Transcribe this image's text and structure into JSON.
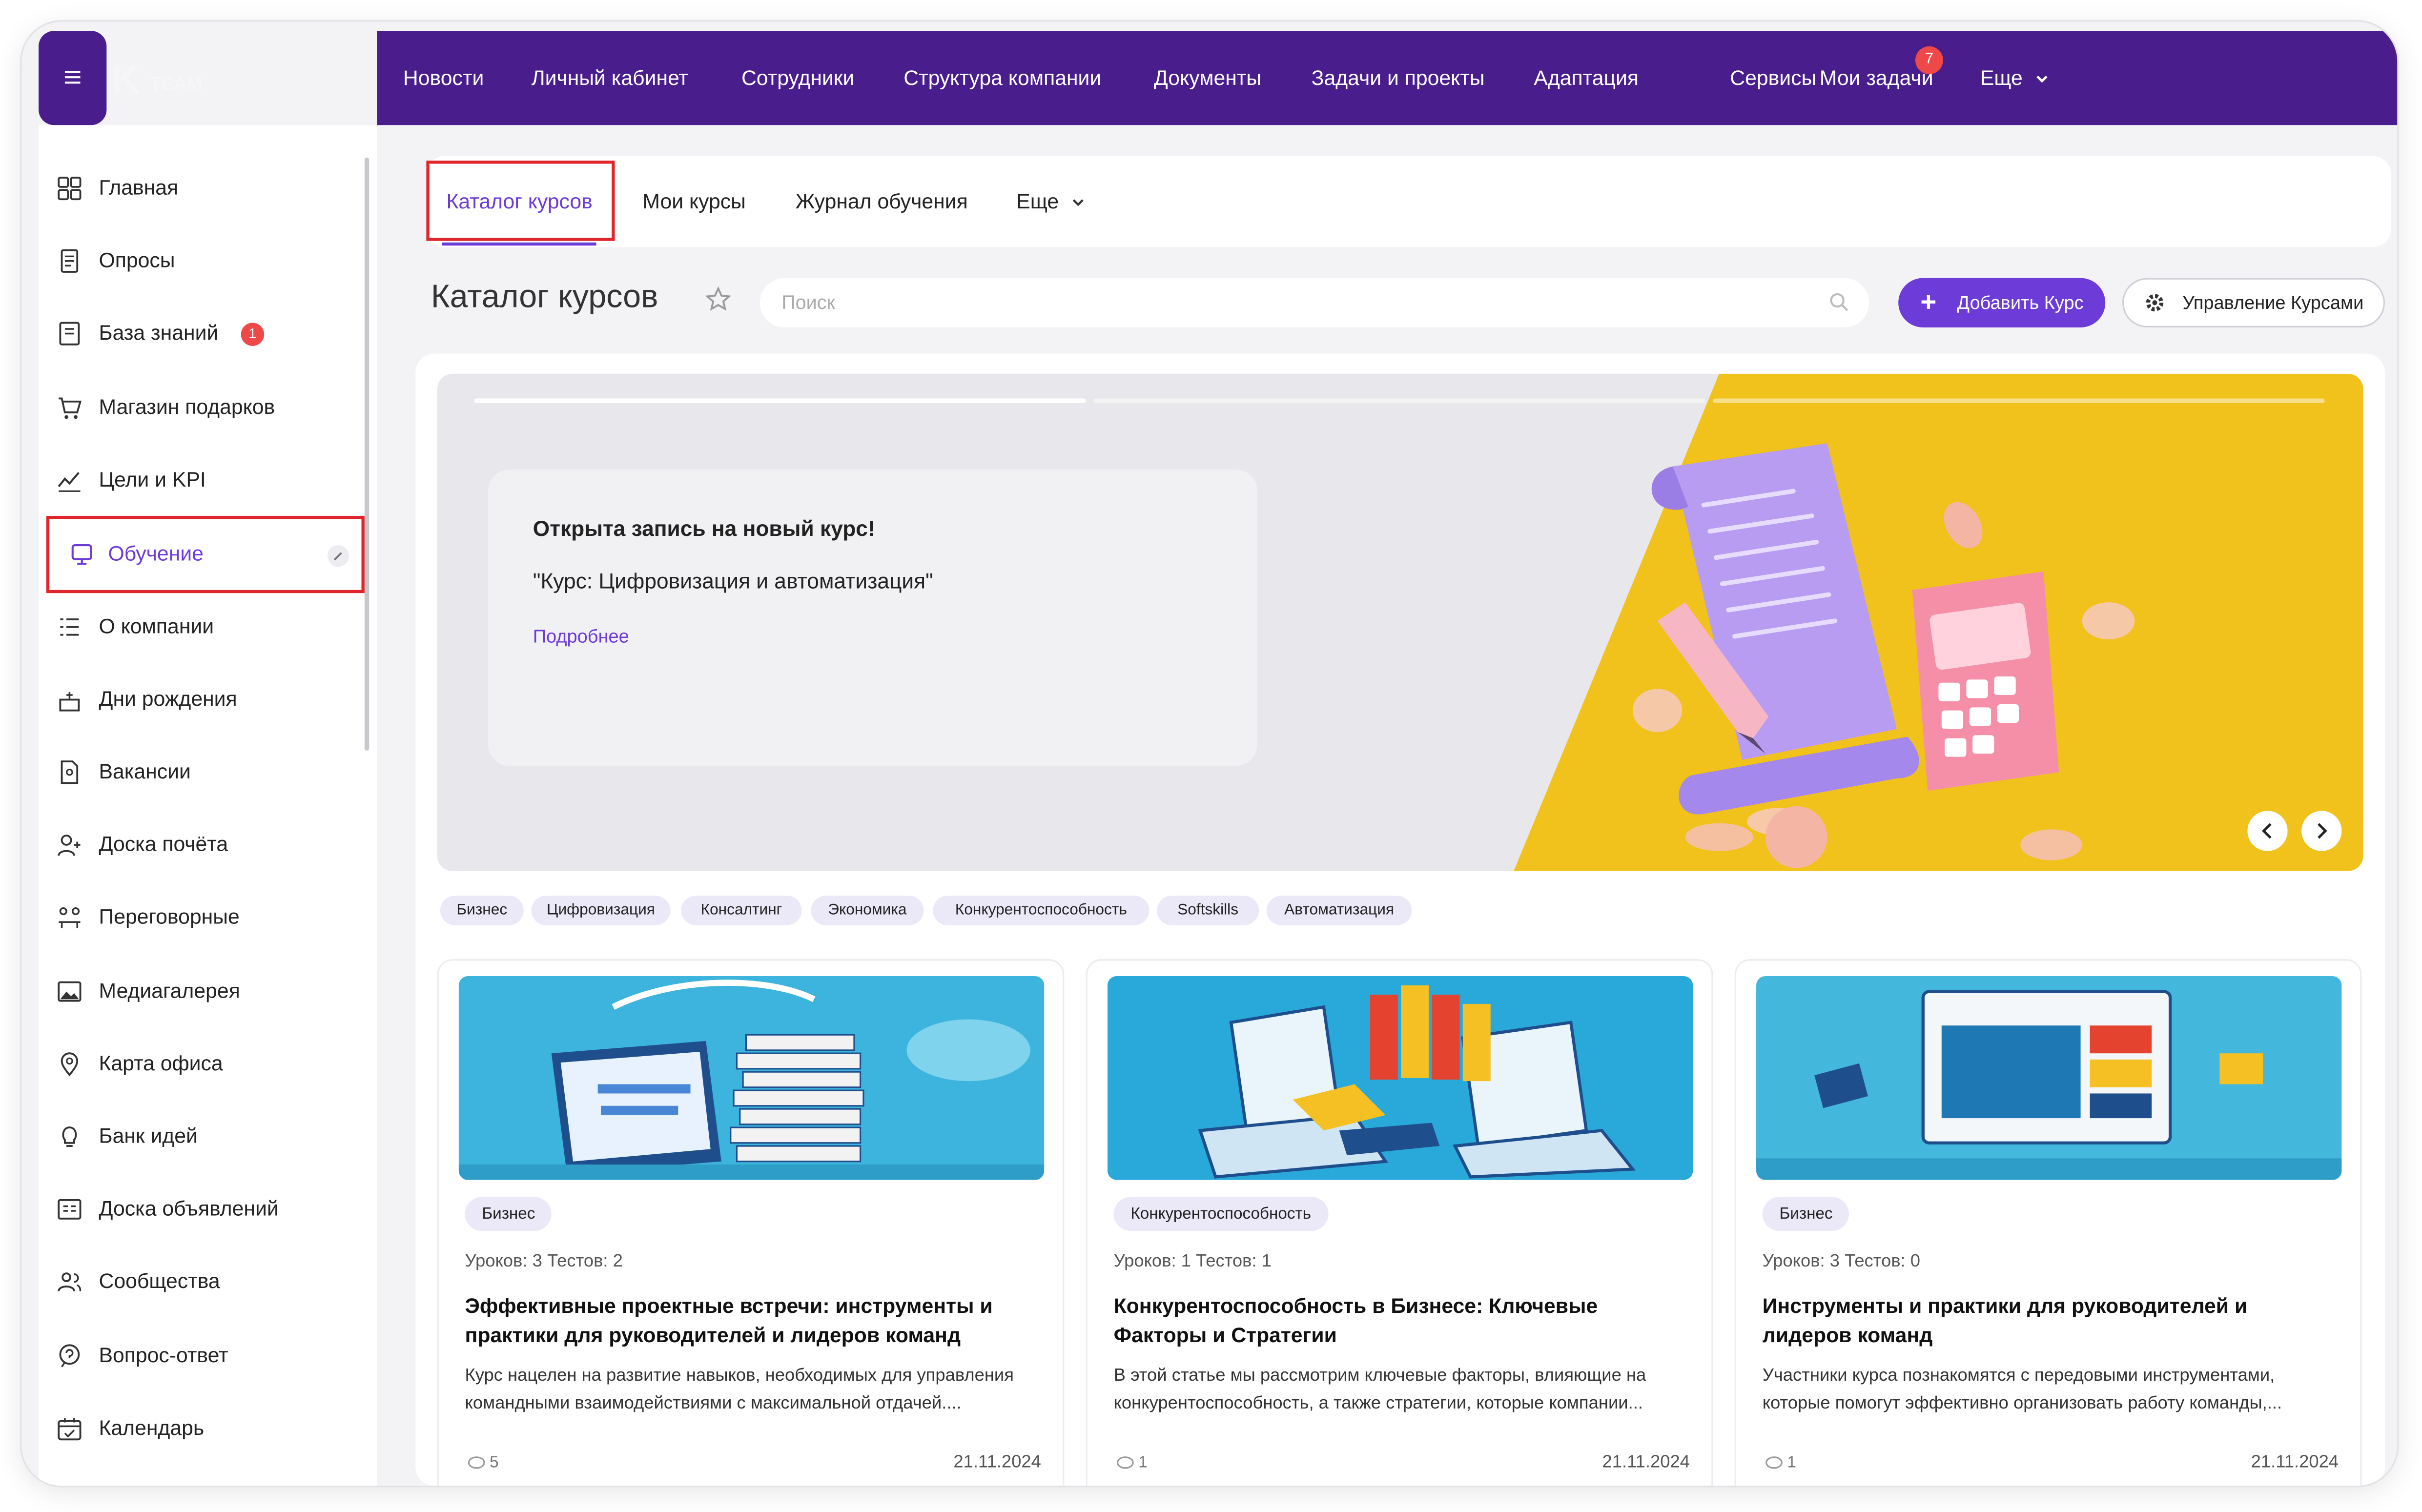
{
  "topnav": {
    "items": [
      "Новости",
      "Личный кабинет",
      "Сотрудники",
      "Структура компании",
      "Документы",
      "Задачи и проекты",
      "Адаптация",
      "Сервисы",
      "Мои задачи",
      "Еще"
    ],
    "tasks_badge": "7",
    "logo_text": "TEAM"
  },
  "sidebar": {
    "items": [
      {
        "label": "Главная",
        "icon": "home-grid-icon"
      },
      {
        "label": "Опросы",
        "icon": "survey-icon"
      },
      {
        "label": "База знаний",
        "icon": "book-icon",
        "badge": "1"
      },
      {
        "label": "Магазин подарков",
        "icon": "cart-icon"
      },
      {
        "label": "Цели и KPI",
        "icon": "kpi-icon"
      },
      {
        "label": "Обучение",
        "icon": "education-icon",
        "active": true
      },
      {
        "label": "О компании",
        "icon": "list-icon"
      },
      {
        "label": "Дни рождения",
        "icon": "cake-icon"
      },
      {
        "label": "Вакансии",
        "icon": "document-person-icon"
      },
      {
        "label": "Доска почёта",
        "icon": "person-plus-icon"
      },
      {
        "label": "Переговорные",
        "icon": "meeting-icon"
      },
      {
        "label": "Медиагалерея",
        "icon": "image-icon"
      },
      {
        "label": "Карта офиса",
        "icon": "map-pin-icon"
      },
      {
        "label": "Банк идей",
        "icon": "lightbulb-icon"
      },
      {
        "label": "Доска объявлений",
        "icon": "board-icon"
      },
      {
        "label": "Сообщества",
        "icon": "people-icon"
      },
      {
        "label": "Вопрос-ответ",
        "icon": "qa-icon"
      },
      {
        "label": "Календарь",
        "icon": "calendar-icon"
      }
    ]
  },
  "tabs": [
    "Каталог курсов",
    "Мои курсы",
    "Журнал обучения",
    "Еще"
  ],
  "header": {
    "title": "Каталог курсов",
    "search_placeholder": "Поиск",
    "add_button": "Добавить Курс",
    "manage_button": "Управление Курсами"
  },
  "banner": {
    "heading": "Открыта запись на новый курс!",
    "course": "\"Курс: Цифровизация и автоматизация\"",
    "link": "Подробнее"
  },
  "tags": [
    "Бизнес",
    "Цифровизация",
    "Консалтинг",
    "Экономика",
    "Конкурентоспособность",
    "Softskills",
    "Автоматизация"
  ],
  "cards": [
    {
      "tag": "Бизнес",
      "meta": "Уроков: 3 Тестов: 2",
      "title": "Эффективные проектные встречи: инструменты и практики для руководителей и лидеров команд",
      "desc": "Курс нацелен на развитие навыков, необходимых для управления командными взаимодействиями с максимальной отдачей....",
      "views": "5",
      "date": "21.11.2024"
    },
    {
      "tag": "Конкурентоспособность",
      "meta": "Уроков: 1 Тестов: 1",
      "title": "Конкурентоспособность в Бизнесе: Ключевые Факторы и Стратегии",
      "desc": "В этой статье мы рассмотрим ключевые факторы, влияющие на конкурентоспособность, а также стратегии, которые компании...",
      "views": "1",
      "date": "21.11.2024"
    },
    {
      "tag": "Бизнес",
      "meta": "Уроков: 3 Тестов: 0",
      "title": "Инструменты и практики для руководителей и лидеров команд",
      "desc": "Участники курса познакомятся с передовыми инструментами, которые помогут эффективно организовать работу команды,...",
      "views": "1",
      "date": "21.11.2024"
    }
  ],
  "colors": {
    "brand": "#4a1d8c",
    "accent": "#6c3bd8",
    "highlight": "#e0262b",
    "banner_yellow": "#f1c21b"
  }
}
